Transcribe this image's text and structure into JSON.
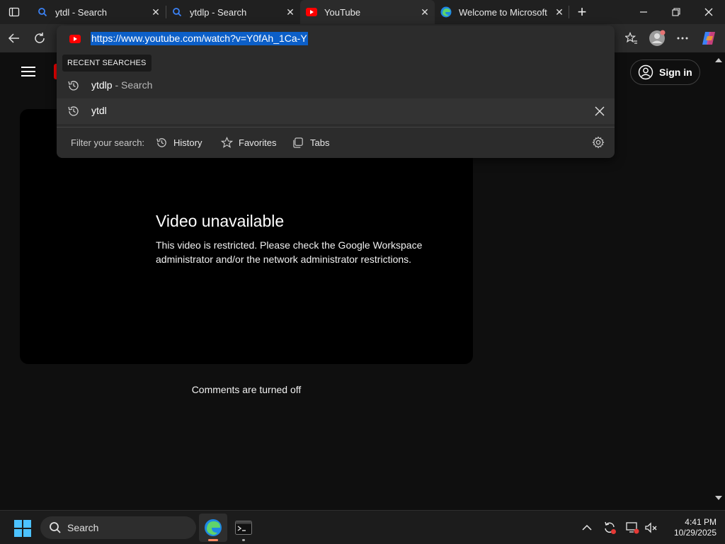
{
  "browser": {
    "tabs": [
      {
        "label": "ytdl - Search",
        "favicon": "search-icon",
        "active": false
      },
      {
        "label": "ytdlp - Search",
        "favicon": "search-icon",
        "active": false
      },
      {
        "label": "YouTube",
        "favicon": "youtube-icon",
        "active": true
      },
      {
        "label": "Welcome to Microsoft E",
        "favicon": "edge-icon",
        "active": false
      }
    ],
    "new_tab": "+",
    "address_bar": {
      "url": "https://www.youtube.com/watch?v=Y0fAh_1Ca-Y"
    }
  },
  "omnibox": {
    "recent_header": "RECENT SEARCHES",
    "suggestions": [
      {
        "text": "ytdlp",
        "sub": " - Search"
      },
      {
        "text": "ytdl",
        "sub": ""
      }
    ],
    "filter_label": "Filter your search:",
    "filters": [
      {
        "label": "History",
        "icon": "history-icon"
      },
      {
        "label": "Favorites",
        "icon": "star-icon"
      },
      {
        "label": "Tabs",
        "icon": "tabs-icon"
      }
    ]
  },
  "page": {
    "signin_label": "Sign in",
    "video_title": "Video unavailable",
    "video_message": "This video is restricted. Please check the Google Workspace administrator and/or the network administrator restrictions.",
    "comments_status": "Comments are turned off"
  },
  "taskbar": {
    "search_placeholder": "Search",
    "time": "4:41 PM",
    "date": "10/29/2025"
  },
  "colors": {
    "accent": "#0c5fc8",
    "youtube_red": "#ff0000",
    "edge_blue": "#1da1f2"
  }
}
